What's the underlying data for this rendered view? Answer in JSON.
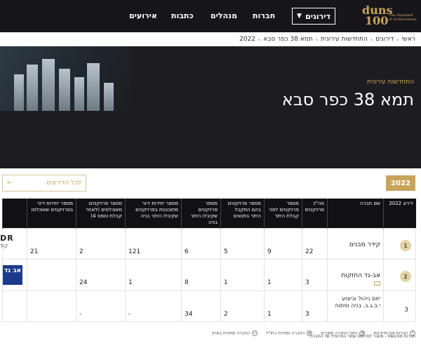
{
  "logo": {
    "word1": "duns",
    "word2": "100",
    "tagline": "The Standard of Achievement"
  },
  "nav": {
    "dropdown_label": "דירוגים",
    "items": [
      "חברות",
      "מנהלים",
      "כתבות",
      "אירועים"
    ]
  },
  "breadcrumb": [
    "ראשי",
    "דירוגים",
    "התחדשות עירונית",
    "תמא 38 כפר סבא",
    "2022"
  ],
  "hero": {
    "subtitle": "התחדשות עירונית",
    "title": "תמא 38 כפר סבא"
  },
  "filters": {
    "year": "2022",
    "all_rankings": "לכל הדירוגים"
  },
  "table": {
    "headers": [
      "דירוג 2022",
      "שם חברה",
      "סה\"כ פרויקטים",
      "מספר פרויקטים לפני קבלת היתר",
      "מספר פרויקטים בהם התקבל היתר בתנאים",
      "מספר פרויקטים שקיבלו היתר בניה",
      "מספר יחידות דיור מתוכננות בפרויקטים שקיבלו היתר בניה",
      "מספר פרויקטים מאוכלסים (לאחר קבלת טופס 4)",
      "מספר יחידות דיור בפרויקטים שאוכלסו",
      ""
    ],
    "rows": [
      {
        "rank": "1",
        "name": "קידר מבנים",
        "total": "22",
        "before_permit": "9",
        "conditional": "5",
        "permit": "6",
        "units_planned": "121",
        "occupied": "2",
        "units_occupied": "21",
        "logo_top": "KEDDR",
        "logo_bottom": "קידר מבנים"
      },
      {
        "rank": "2",
        "name": "אב-גד החזקות",
        "total": "3",
        "before_permit": "1",
        "conditional": "1",
        "permit": "8",
        "units_planned": "1",
        "occupied": "24",
        "units_occupied": "",
        "logo_top": "אב גד",
        "logo_bottom": ""
      },
      {
        "rank": "3",
        "name": "יזום ניהול וביצוע י.ב.ג.ב. בניה ופתוח",
        "total": "3",
        "before_permit": "1",
        "conditional": "2",
        "permit": "34",
        "units_planned": "-",
        "occupied": "-",
        "units_occupied": "",
        "logo_top": "",
        "logo_bottom": ""
      }
    ]
  },
  "legend": {
    "items": [
      "חברות אם מדורגות",
      "נתוני החברה מוצרים",
      "החברה נסחרת בחו\"ל",
      "החברה נסחרת בארץ"
    ],
    "note": "חברות מודגשות - מעבר לפרסום עמוד הפרופיל של החברה"
  },
  "colors": {
    "gold": "#c8a45a",
    "dark": "#16161a",
    "green": "#1f8a3a"
  }
}
